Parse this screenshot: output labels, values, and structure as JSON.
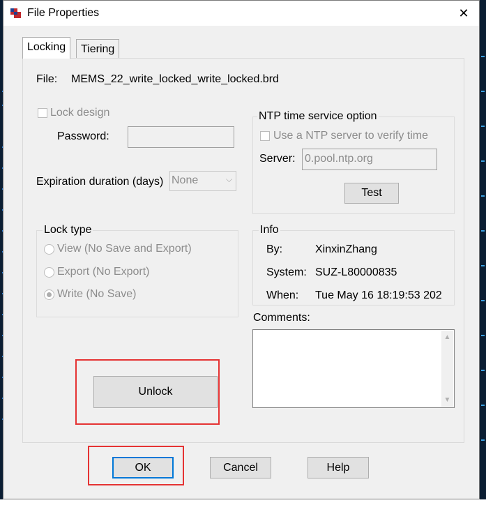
{
  "window": {
    "title": "File Properties",
    "close_glyph": "✕",
    "app_icon": "allegro-app-icon"
  },
  "tabs": [
    {
      "label": "Locking",
      "active": true
    },
    {
      "label": "Tiering",
      "active": false
    }
  ],
  "file": {
    "label": "File:",
    "name": "MEMS_22_write_locked_write_locked.brd"
  },
  "lock_design": {
    "label": "Lock design",
    "checked": false,
    "password_label": "Password:",
    "password_value": ""
  },
  "expiration": {
    "label": "Expiration duration (days)",
    "value": "None"
  },
  "lock_type": {
    "title": "Lock type",
    "options": [
      {
        "label": "View (No Save and Export)",
        "selected": false
      },
      {
        "label": "Export (No Export)",
        "selected": false
      },
      {
        "label": "Write (No Save)",
        "selected": true
      }
    ]
  },
  "ntp": {
    "title": "NTP time service option",
    "use_ntp_label": "Use a NTP server to verify time",
    "use_ntp_checked": false,
    "server_label": "Server:",
    "server_value": "0.pool.ntp.org",
    "test_button": "Test"
  },
  "info": {
    "title": "Info",
    "by_label": "By:",
    "by_value": "XinxinZhang",
    "system_label": "System:",
    "system_value": "SUZ-L80000835",
    "when_label": "When:",
    "when_value": "Tue May 16 18:19:53 202"
  },
  "comments": {
    "label": "Comments:",
    "value": ""
  },
  "buttons": {
    "unlock": "Unlock",
    "ok": "OK",
    "cancel": "Cancel",
    "help": "Help"
  },
  "colors": {
    "highlight": "#e53333",
    "focus": "#0078d7"
  }
}
